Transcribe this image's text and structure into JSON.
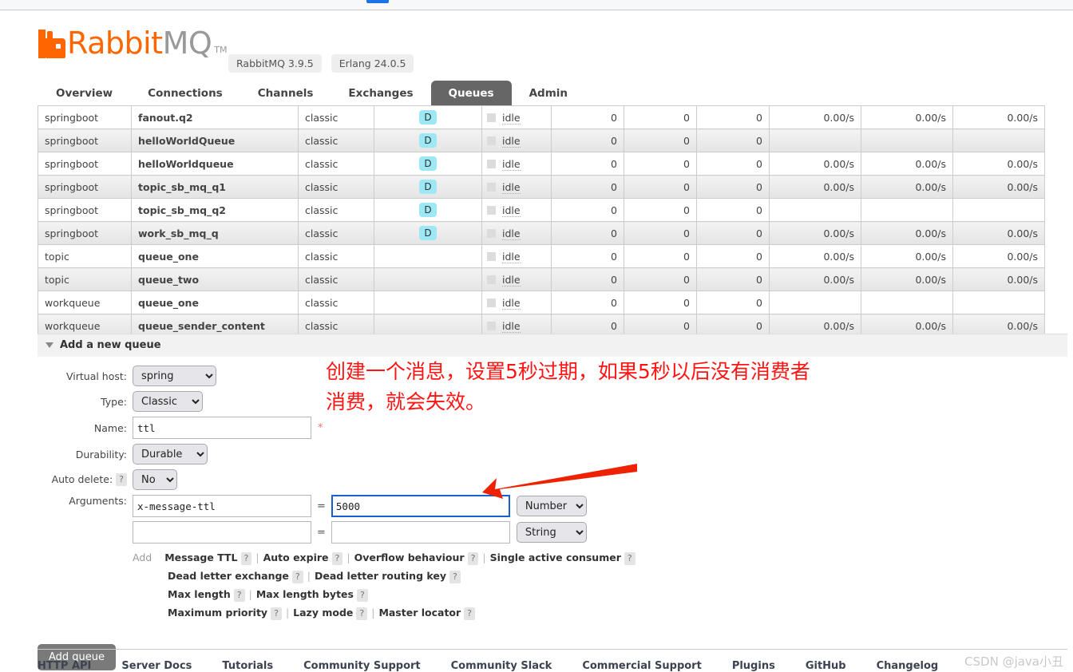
{
  "browser": {
    "tab_accent_color": "#1a73e8"
  },
  "header": {
    "logo_rabbit": "Rabbit",
    "logo_mq": "MQ",
    "logo_tm": "TM",
    "version_rabbitmq": "RabbitMQ 3.9.5",
    "version_erlang": "Erlang 24.0.5"
  },
  "nav": {
    "tabs": [
      {
        "label": "Overview",
        "active": false
      },
      {
        "label": "Connections",
        "active": false
      },
      {
        "label": "Channels",
        "active": false
      },
      {
        "label": "Exchanges",
        "active": false
      },
      {
        "label": "Queues",
        "active": true
      },
      {
        "label": "Admin",
        "active": false
      }
    ]
  },
  "queues_table": {
    "rows": [
      {
        "vhost": "springboot",
        "name": "fanout.q2",
        "type": "classic",
        "features": "D",
        "state": "idle",
        "ready": "0",
        "unacked": "0",
        "total": "0",
        "incoming": "0.00/s",
        "deliver_get": "0.00/s",
        "ack": "0.00/s"
      },
      {
        "vhost": "springboot",
        "name": "helloWorldQueue",
        "type": "classic",
        "features": "D",
        "state": "idle",
        "ready": "0",
        "unacked": "0",
        "total": "0",
        "incoming": "",
        "deliver_get": "",
        "ack": ""
      },
      {
        "vhost": "springboot",
        "name": "helloWorldqueue",
        "type": "classic",
        "features": "D",
        "state": "idle",
        "ready": "0",
        "unacked": "0",
        "total": "0",
        "incoming": "0.00/s",
        "deliver_get": "0.00/s",
        "ack": "0.00/s"
      },
      {
        "vhost": "springboot",
        "name": "topic_sb_mq_q1",
        "type": "classic",
        "features": "D",
        "state": "idle",
        "ready": "0",
        "unacked": "0",
        "total": "0",
        "incoming": "0.00/s",
        "deliver_get": "0.00/s",
        "ack": "0.00/s"
      },
      {
        "vhost": "springboot",
        "name": "topic_sb_mq_q2",
        "type": "classic",
        "features": "D",
        "state": "idle",
        "ready": "0",
        "unacked": "0",
        "total": "0",
        "incoming": "",
        "deliver_get": "",
        "ack": ""
      },
      {
        "vhost": "springboot",
        "name": "work_sb_mq_q",
        "type": "classic",
        "features": "D",
        "state": "idle",
        "ready": "0",
        "unacked": "0",
        "total": "0",
        "incoming": "0.00/s",
        "deliver_get": "0.00/s",
        "ack": "0.00/s"
      },
      {
        "vhost": "topic",
        "name": "queue_one",
        "type": "classic",
        "features": "",
        "state": "idle",
        "ready": "0",
        "unacked": "0",
        "total": "0",
        "incoming": "0.00/s",
        "deliver_get": "0.00/s",
        "ack": "0.00/s"
      },
      {
        "vhost": "topic",
        "name": "queue_two",
        "type": "classic",
        "features": "",
        "state": "idle",
        "ready": "0",
        "unacked": "0",
        "total": "0",
        "incoming": "0.00/s",
        "deliver_get": "0.00/s",
        "ack": "0.00/s"
      },
      {
        "vhost": "workqueue",
        "name": "queue_one",
        "type": "classic",
        "features": "",
        "state": "idle",
        "ready": "0",
        "unacked": "0",
        "total": "0",
        "incoming": "",
        "deliver_get": "",
        "ack": ""
      },
      {
        "vhost": "workqueue",
        "name": "queue_sender_content",
        "type": "classic",
        "features": "",
        "state": "idle",
        "ready": "0",
        "unacked": "0",
        "total": "0",
        "incoming": "0.00/s",
        "deliver_get": "0.00/s",
        "ack": "0.00/s"
      }
    ]
  },
  "add_queue": {
    "section_title": "Add a new queue",
    "labels": {
      "virtual_host": "Virtual host:",
      "type": "Type:",
      "name": "Name:",
      "durability": "Durability:",
      "auto_delete": "Auto delete:",
      "arguments": "Arguments:"
    },
    "values": {
      "virtual_host": "spring",
      "type": "Classic",
      "name": "ttl",
      "durability": "Durable",
      "auto_delete": "No",
      "arg1_key": "x-message-ttl",
      "arg1_value": "5000",
      "arg1_type": "Number",
      "arg2_key": "",
      "arg2_value": "",
      "arg2_type": "String"
    },
    "required_marker": "*",
    "equals_sign": "=",
    "help_marker": "?",
    "add_word": "Add",
    "presets_row1": [
      "Message TTL",
      "Auto expire",
      "Overflow behaviour",
      "Single active consumer"
    ],
    "presets_row2": [
      "Dead letter exchange",
      "Dead letter routing key"
    ],
    "presets_row3": [
      "Max length",
      "Max length bytes"
    ],
    "presets_row4": [
      "Maximum priority",
      "Lazy mode",
      "Master locator"
    ],
    "submit_label": "Add queue"
  },
  "footer": {
    "links": [
      "HTTP API",
      "Server Docs",
      "Tutorials",
      "Community Support",
      "Community Slack",
      "Commercial Support",
      "Plugins",
      "GitHub",
      "Changelog"
    ]
  },
  "annotations": {
    "note_text": "创建一个消息，设置5秒过期，如果5秒以后没有消费者消费，就会失效。",
    "note_color": "#ff1414",
    "arrow_color": "#ee2200",
    "watermark": "CSDN @java小丑"
  }
}
